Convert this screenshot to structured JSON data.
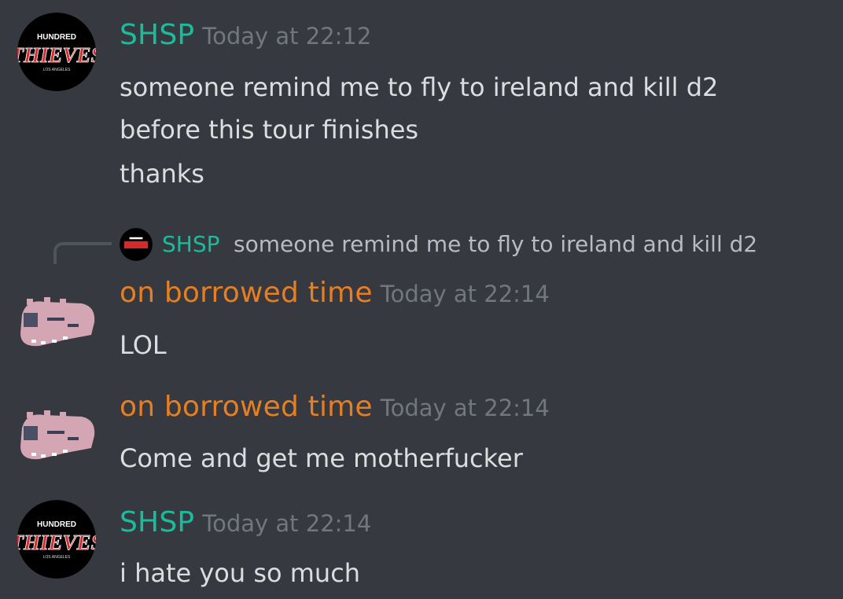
{
  "colors": {
    "background": "#36393f",
    "shsp": "#1abc9c",
    "borrowed": "#e67e22",
    "timestamp": "#72767d",
    "text": "#dcddde"
  },
  "avatars": {
    "shsp": {
      "icon": "hundred-thieves-logo",
      "line1": "HUNDRED",
      "line2": "THIEVES",
      "line3": "LOS ANGELES"
    },
    "borrowed": {
      "icon": "pink-ghost-pixel-avatar"
    }
  },
  "messages": [
    {
      "username": "SHSP",
      "timestamp": "Today at 22:12",
      "lines": [
        "someone remind me to fly to ireland and kill d2",
        "before this tour finishes",
        "thanks"
      ]
    },
    {
      "reply": {
        "username": "SHSP",
        "text": "someone remind me to fly to ireland and kill d2"
      },
      "username": "on borrowed time",
      "timestamp": "Today at 22:14",
      "lines": [
        "LOL"
      ]
    },
    {
      "username": "on borrowed time",
      "timestamp": "Today at 22:14",
      "lines": [
        "Come and get me motherfucker"
      ]
    },
    {
      "username": "SHSP",
      "timestamp": "Today at 22:14",
      "lines": [
        "i hate you so much"
      ]
    }
  ]
}
